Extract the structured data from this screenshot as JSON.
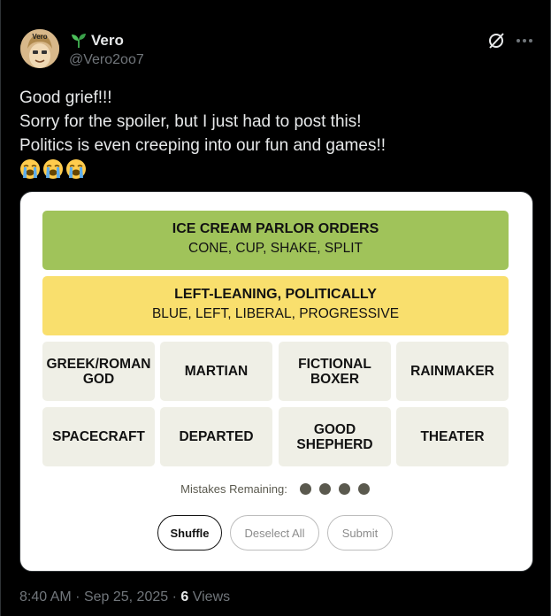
{
  "author": {
    "display_name": "Vero",
    "handle": "@Vero2oo7",
    "avatar_text": "Vero",
    "badge_icon": "sprout-icon"
  },
  "tweet": {
    "lines": [
      "Good grief!!!",
      "Sorry for the spoiler, but I just had to post this!",
      "Politics is even creeping into our fun and games!!"
    ],
    "emojis": [
      "loudly-crying-face",
      "loudly-crying-face",
      "loudly-crying-face"
    ]
  },
  "puzzle": {
    "solved_groups": [
      {
        "title": "ICE CREAM PARLOR ORDERS",
        "words": "CONE, CUP, SHAKE, SPLIT",
        "color": "#a0c35a"
      },
      {
        "title": "LEFT-LEANING, POLITICALLY",
        "words": "BLUE, LEFT, LIBERAL, PROGRESSIVE",
        "color": "#f9df6d"
      }
    ],
    "tiles": [
      "GREEK/ROMAN GOD",
      "MARTIAN",
      "FICTIONAL BOXER",
      "RAINMAKER",
      "SPACECRAFT",
      "DEPARTED",
      "GOOD SHEPHERD",
      "THEATER"
    ],
    "mistakes_label": "Mistakes Remaining:",
    "mistakes_remaining": 4,
    "buttons": {
      "shuffle": "Shuffle",
      "deselect": "Deselect All",
      "submit": "Submit"
    }
  },
  "meta": {
    "time": "8:40 AM",
    "date": "Sep 25, 2025",
    "views_count": "6",
    "views_label": "Views"
  },
  "colors": {
    "background": "#000000",
    "text": "#e7e9ea",
    "muted": "#71767b",
    "tile": "#efefe6"
  }
}
